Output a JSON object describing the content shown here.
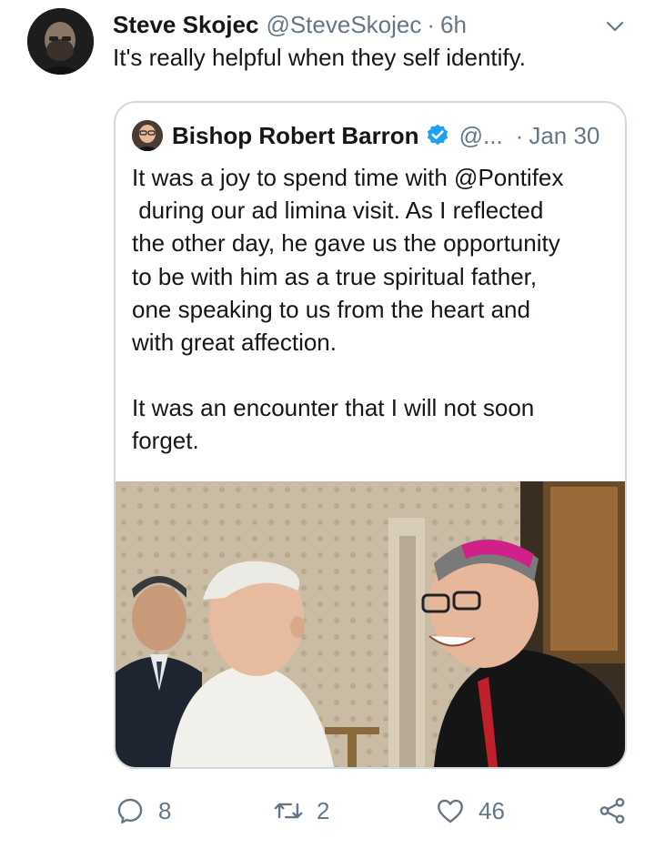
{
  "tweet": {
    "author_name": "Steve Skojec",
    "author_handle": "@SteveSkojec",
    "separator": "·",
    "time": "6h",
    "text": "It's really helpful when they self identify."
  },
  "quoted": {
    "author_name": "Bishop Robert Barron",
    "author_handle": "@...",
    "separator": "·",
    "time": "Jan 30",
    "text_lines_p1": [
      "It was a joy to spend time with @Pontifex",
      " during our ad limina visit. As I reflected",
      "the other day, he gave us the opportunity",
      "to be with him as a true spiritual father,",
      "one speaking to us from the heart and",
      "with great affection."
    ],
    "text_lines_p2": [
      "It was an encounter that I will not soon",
      "forget."
    ]
  },
  "actions": {
    "reply_count": "8",
    "retweet_count": "2",
    "like_count": "46"
  },
  "icons": {
    "more": "chevron-down-icon",
    "verified": "verified-badge-icon",
    "reply": "reply-icon",
    "retweet": "retweet-icon",
    "like": "heart-icon",
    "share": "share-icon"
  },
  "colors": {
    "text": "#14171a",
    "muted": "#657786",
    "verified_blue": "#1da1f2",
    "card_border": "#cfd9de"
  }
}
